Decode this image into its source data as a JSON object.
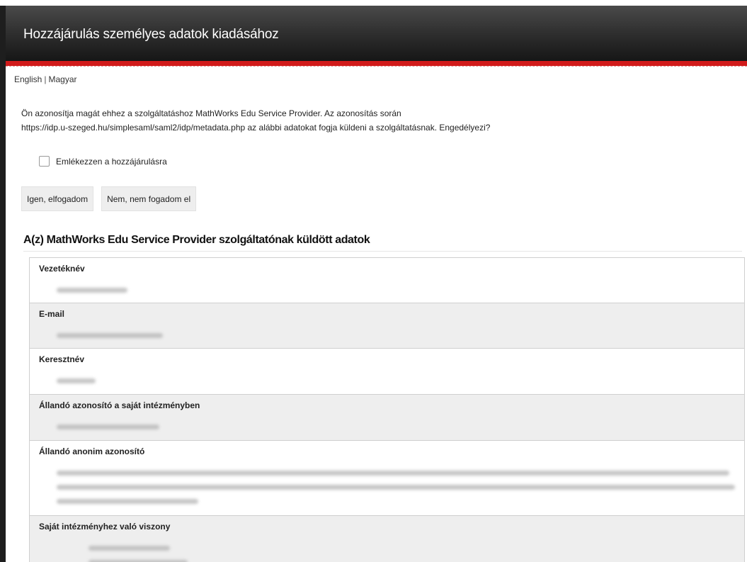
{
  "page": {
    "title": "Hozzájárulás személyes adatok kiadásához",
    "languages": [
      "English",
      "Magyar"
    ],
    "language_separator": "|"
  },
  "consent": {
    "intro_line1": "Ön azonosítja magát ehhez a szolgáltatáshoz MathWorks Edu Service Provider. Az azonosítás során",
    "intro_line2": "https://idp.u-szeged.hu/simplesaml/saml2/idp/metadata.php az alábbi adatokat fogja küldeni a szolgáltatásnak. Engedélyezi?",
    "remember_label": "Emlékezzen a hozzájárulásra",
    "remember_checked": false,
    "accept_button": "Igen, elfogadom",
    "reject_button": "Nem, nem fogadom el"
  },
  "attributes_section": {
    "title": "A(z) MathWorks Edu Service Provider szolgáltatónak küldött adatok",
    "items": [
      {
        "name": "Vezetéknév",
        "value_obscured": true
      },
      {
        "name": "E-mail",
        "value_obscured": true
      },
      {
        "name": "Keresztnév",
        "value_obscured": true
      },
      {
        "name": "Állandó azonosító a saját intézményben",
        "value_obscured": true
      },
      {
        "name": "Állandó anonim azonosító",
        "value_obscured": true
      },
      {
        "name": "Saját intézményhez való viszony",
        "value_obscured": true
      }
    ]
  },
  "colors": {
    "header_bg": "#2c2c2c",
    "accent_red": "#d11a1a",
    "row_alt_bg": "#eeeeee"
  }
}
